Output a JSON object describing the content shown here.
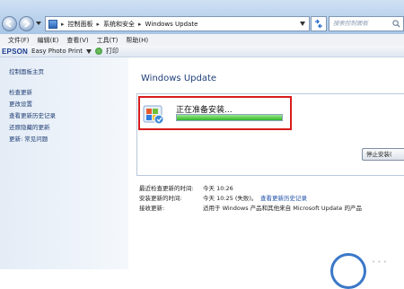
{
  "address": {
    "crumbs": [
      "控制面板",
      "系统和安全",
      "Windows Update"
    ],
    "search_placeholder": "搜索控制面板"
  },
  "menu": [
    "文件(F)",
    "编辑(E)",
    "查看(V)",
    "工具(T)",
    "帮助(H)"
  ],
  "toolbar": {
    "brand": "EPSON",
    "app": "Easy Photo Print",
    "print": "打印"
  },
  "sidebar": {
    "home": "控制面板主页",
    "links": [
      "检查更新",
      "更改设置",
      "查看更新历史记录",
      "还原隐藏的更新",
      "更新: 常见问题"
    ]
  },
  "main": {
    "title": "Windows Update",
    "status": "正在准备安装...",
    "progress": 1.0,
    "stop_button": "停止安装(",
    "info": {
      "last_check_label": "最近检查更新的时间:",
      "last_check_value": "今天 10:26",
      "installed_label": "安装更新的时间:",
      "installed_value": "今天 10:25 (失败)。",
      "history_link": "查看更新历史记录",
      "receive_label": "接收更新:",
      "receive_value": "适用于 Windows 产品和其他来自 Microsoft Update 的产品"
    }
  },
  "watermark": "• • •"
}
